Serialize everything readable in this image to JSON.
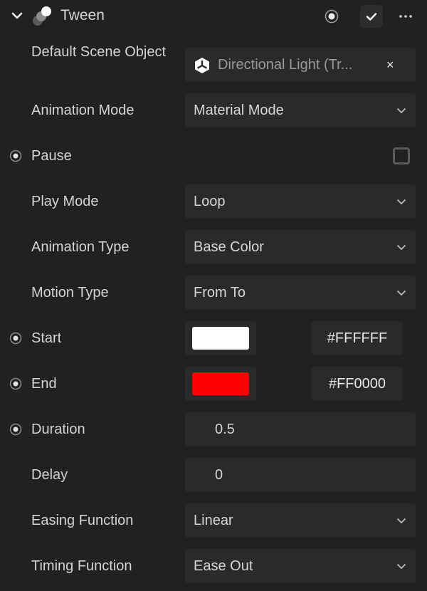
{
  "header": {
    "title": "Tween"
  },
  "fields": {
    "default_scene_object": {
      "label": "Default Scene Object",
      "value": "Directional Light (Tr...",
      "clear": "×"
    },
    "animation_mode": {
      "label": "Animation Mode",
      "value": "Material Mode"
    },
    "pause": {
      "label": "Pause",
      "checked": false
    },
    "play_mode": {
      "label": "Play Mode",
      "value": "Loop"
    },
    "animation_type": {
      "label": "Animation Type",
      "value": "Base Color"
    },
    "motion_type": {
      "label": "Motion Type",
      "value": "From To"
    },
    "start": {
      "label": "Start",
      "color": "#FFFFFF",
      "hex": "#FFFFFF"
    },
    "end": {
      "label": "End",
      "color": "#FF0000",
      "hex": "#FF0000"
    },
    "duration": {
      "label": "Duration",
      "value": "0.5"
    },
    "delay": {
      "label": "Delay",
      "value": "0"
    },
    "easing_function": {
      "label": "Easing Function",
      "value": "Linear"
    },
    "timing_function": {
      "label": "Timing Function",
      "value": "Ease Out"
    }
  }
}
